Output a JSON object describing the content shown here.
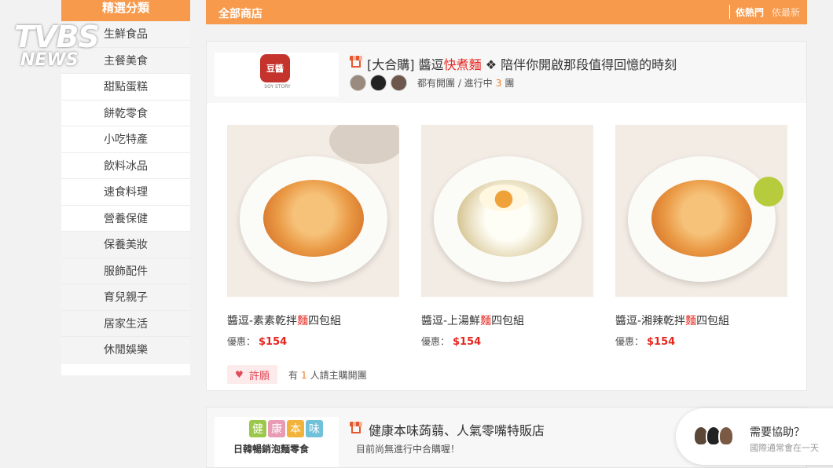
{
  "watermark": {
    "line1": "TVBS",
    "line2": "NEWS"
  },
  "sidebar": {
    "header": "精選分類",
    "items": [
      {
        "label": "生鮮食品"
      },
      {
        "label": "主餐美食"
      },
      {
        "label": "甜點蛋糕"
      },
      {
        "label": "餅乾零食"
      },
      {
        "label": "小吃特產"
      },
      {
        "label": "飲料冰品"
      },
      {
        "label": "速食料理"
      },
      {
        "label": "營養保健"
      },
      {
        "label": "保養美妝"
      },
      {
        "label": "服飾配件"
      },
      {
        "label": "育兒親子"
      },
      {
        "label": "居家生活"
      },
      {
        "label": "休閒娛樂"
      }
    ]
  },
  "topbar": {
    "title": "全部商店",
    "sort_popular": "依熱門",
    "sort_newest": "依最新"
  },
  "store1": {
    "logo_seal": "豆醬",
    "logo_sub": "SOY STORY",
    "title_prefix": "[大合購] 醬逗",
    "title_highlight": "快煮麵",
    "title_suffix": "❖ 陪伴你開啟那段值得回憶的時刻",
    "status_prefix": "都有開團 / 進行中",
    "status_count": "3",
    "status_suffix": "團",
    "products": [
      {
        "name_prefix": "醬逗-素素乾拌",
        "name_highlight": "麵",
        "name_suffix": "四包組",
        "price_label": "優惠：",
        "price": "$154"
      },
      {
        "name_prefix": "醬逗-上湯鮮",
        "name_highlight": "麵",
        "name_suffix": "四包組",
        "price_label": "優惠：",
        "price": "$154"
      },
      {
        "name_prefix": "醬逗-湘辣乾拌",
        "name_highlight": "麵",
        "name_suffix": "四包組",
        "price_label": "優惠：",
        "price": "$154"
      }
    ],
    "wish_label": "許願",
    "wish_note_prefix": "有",
    "wish_note_count": "1",
    "wish_note_suffix": "人請主購開團"
  },
  "store2": {
    "logo_tiles": [
      "健",
      "康",
      "本",
      "味"
    ],
    "logo_sub": "日韓暢銷泡麵零食",
    "title": "健康本味蒟蒻、人氣零嘴特販店",
    "status": "目前尚無進行中合購喔！"
  },
  "help": {
    "title": "需要協助？",
    "subtitle": "國際通常會在一天"
  },
  "colors": {
    "accent": "#f79a4c",
    "price": "#e5261f",
    "count": "#f07c2a"
  }
}
